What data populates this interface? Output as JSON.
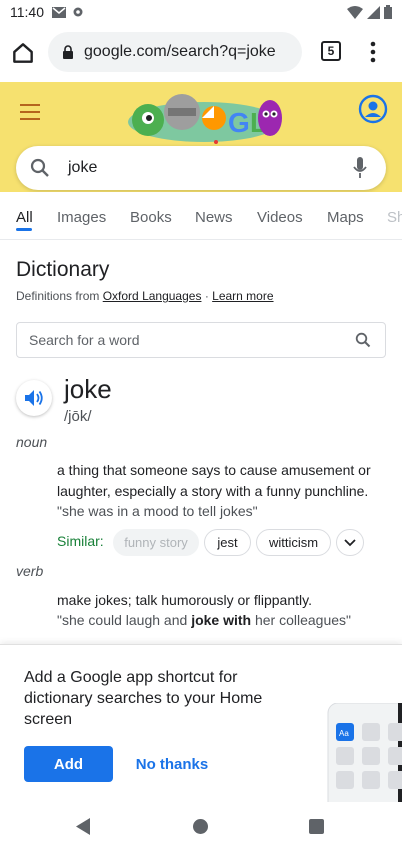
{
  "status_bar": {
    "time": "11:40",
    "icons": [
      "gmail-icon",
      "settings-icon",
      "wifi-icon",
      "signal-icon",
      "battery-icon"
    ]
  },
  "browser": {
    "url": "google.com/search?q=joke",
    "tab_count": "5"
  },
  "search": {
    "query": "joke"
  },
  "tabs": [
    "All",
    "Images",
    "Books",
    "News",
    "Videos",
    "Maps",
    "Sh"
  ],
  "dictionary": {
    "title": "Dictionary",
    "source_prefix": "Definitions from",
    "source_link": "Oxford Languages",
    "separator": "·",
    "learn_more": "Learn more",
    "word_search_placeholder": "Search for a word",
    "word": "joke",
    "phonetic": "/jōk/",
    "senses": [
      {
        "pos": "noun",
        "definition": "a thing that someone says to cause amusement or laughter, especially a story with a funny punchline.",
        "example": "\"she was in a mood to tell jokes\"",
        "similar_label": "Similar:",
        "similar": [
          "funny story",
          "jest",
          "witticism"
        ]
      },
      {
        "pos": "verb",
        "definition": "make jokes; talk humorously or flippantly.",
        "example_start": "\"she could laugh and ",
        "example_bold": "joke with",
        "example_end": " her colleagues\""
      }
    ]
  },
  "bottom_sheet": {
    "message": "Add a Google app shortcut for dictionary searches to your Home screen",
    "add_label": "Add",
    "dismiss_label": "No thanks"
  },
  "colors": {
    "accent": "#1a73e8",
    "doodle_bg": "#f6e16f",
    "similar_green": "#188038"
  }
}
